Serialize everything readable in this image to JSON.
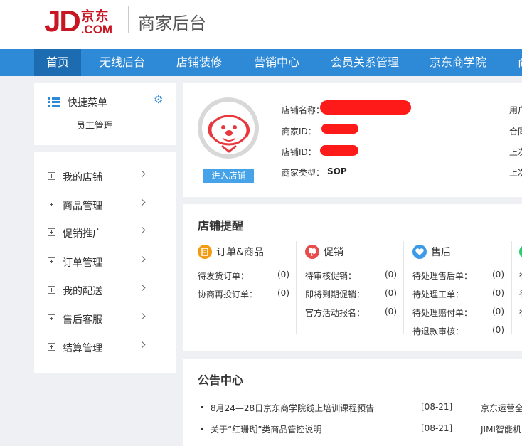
{
  "header": {
    "logo_jd": "JD",
    "logo_cn": "京东",
    "logo_com": ".COM",
    "title": "商家后台"
  },
  "nav": {
    "items": [
      "首页",
      "无线后台",
      "店铺装修",
      "营销中心",
      "会员关系管理",
      "京东商学院",
      "商"
    ],
    "active_index": 0,
    "color": "#2e89d6",
    "active_color": "#1d6cb1"
  },
  "quick_menu": {
    "title": "快捷菜单",
    "icon": "list-icon",
    "settings_icon": "gear-icon",
    "items": [
      "员工管理"
    ]
  },
  "sidebar": {
    "items": [
      {
        "label": "我的店铺"
      },
      {
        "label": "商品管理"
      },
      {
        "label": "促销推广"
      },
      {
        "label": "订单管理"
      },
      {
        "label": "我的配送"
      },
      {
        "label": "售后客服"
      },
      {
        "label": "结算管理"
      }
    ]
  },
  "store_info": {
    "enter_button": "进入店铺",
    "labels": {
      "name": "店铺名称：",
      "merchant_id": "商家ID：",
      "store_id": "店铺ID：",
      "type": "商家类型："
    },
    "type_value": "SOP",
    "right_labels": [
      "用户",
      "合同",
      "上次",
      "上次"
    ],
    "redaction_color": "#ff1a1a"
  },
  "reminders": {
    "title": "店铺提醒",
    "columns": [
      {
        "title": "订单&商品",
        "icon": "order-icon",
        "color": "#f39c12",
        "rows": [
          {
            "label": "待发货订单：",
            "value": "(0)"
          },
          {
            "label": "协商再投订单：",
            "value": "(0)"
          }
        ]
      },
      {
        "title": "促销",
        "icon": "balloon-icon",
        "color": "#e84c4c",
        "rows": [
          {
            "label": "待审核促销：",
            "value": "(0)"
          },
          {
            "label": "即将到期促销：",
            "value": "(0)"
          },
          {
            "label": "官方活动报名：",
            "value": "(0)"
          }
        ]
      },
      {
        "title": "售后",
        "icon": "heart-icon",
        "color": "#3b9be8",
        "rows": [
          {
            "label": "待处理售后单：",
            "value": "(0)"
          },
          {
            "label": "待处理工单：",
            "value": "(0)"
          },
          {
            "label": "待处理赔付单：",
            "value": "(0)"
          },
          {
            "label": "待退款审核：",
            "value": "(0)"
          }
        ]
      }
    ],
    "partial_labels": [
      "待",
      "待",
      "待"
    ]
  },
  "notices": {
    "title": "公告中心",
    "items": [
      {
        "text": "8月24—28日京东商学院线上培训课程预告",
        "date": "[08-21]",
        "right": "京东运营全"
      },
      {
        "text": "关于“红珊瑚”类商品管控说明",
        "date": "[08-21]",
        "right": "JIMI智能机"
      }
    ]
  }
}
